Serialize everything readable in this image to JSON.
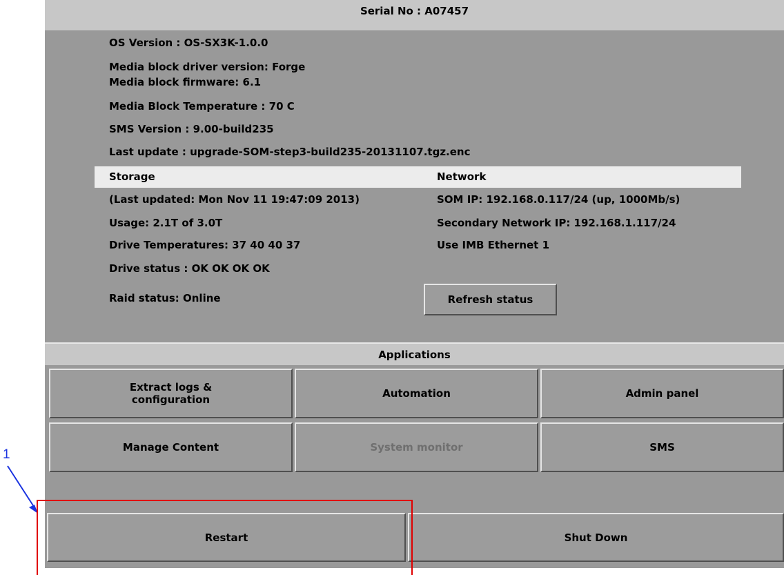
{
  "header": {
    "serial": "Serial No : A07457"
  },
  "system_info": {
    "os_version": "OS Version : OS-SX3K-1.0.0",
    "media_driver": "Media block driver version: Forge",
    "media_firmware": "Media block firmware: 6.1",
    "media_temp": "Media Block Temperature : 70 C",
    "sms_version": "SMS Version : 9.00-build235",
    "last_update": "Last update : upgrade-SOM-step3-build235-20131107.tgz.enc"
  },
  "storage": {
    "title": "Storage",
    "last_updated": "(Last updated: Mon Nov 11 19:47:09 2013)",
    "usage": "Usage: 2.1T of 3.0T",
    "drive_temps": "Drive Temperatures: 37 40 40 37",
    "drive_status": "Drive status : OK OK OK OK",
    "raid_status": "Raid status: Online"
  },
  "network": {
    "title": "Network",
    "som_ip": "SOM IP: 192.168.0.117/24 (up, 1000Mb/s)",
    "secondary_ip": "Secondary Network IP: 192.168.1.117/24",
    "ethernet": "Use IMB Ethernet 1",
    "refresh_label": "Refresh status"
  },
  "applications": {
    "title": "Applications",
    "extract_line1": "Extract logs &",
    "extract_line2": "configuration",
    "automation": "Automation",
    "admin_panel": "Admin panel",
    "manage_content": "Manage Content",
    "system_monitor": "System monitor",
    "sms": "SMS"
  },
  "power": {
    "restart": "Restart",
    "shutdown": "Shut Down"
  },
  "annotation": {
    "number": "1",
    "box_color": "#e00000",
    "arrow_color": "#1a33e0"
  }
}
